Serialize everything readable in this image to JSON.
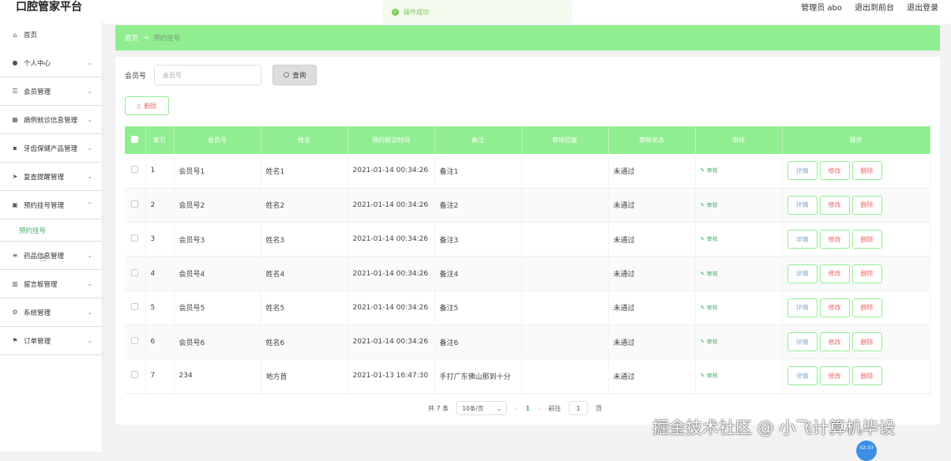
{
  "app": {
    "title": "口腔管家平台"
  },
  "header": {
    "admin_label": "管理员 abo",
    "back_label": "退出到前台",
    "logout_label": "退出登录"
  },
  "toast": {
    "text": "操作成功"
  },
  "sidebar": {
    "items": [
      {
        "label": "首页",
        "icon": "home-icon",
        "glyph": "⌂",
        "chevron": false
      },
      {
        "label": "个人中心",
        "icon": "user-icon",
        "glyph": "●",
        "chevron": true
      },
      {
        "label": "会员管理",
        "icon": "sliders-icon",
        "glyph": "☰",
        "chevron": true
      },
      {
        "label": "病例就诊信息管理",
        "icon": "grid-icon",
        "glyph": "▦",
        "chevron": true
      },
      {
        "label": "牙齿保健产品管理",
        "icon": "tiles-icon",
        "glyph": "▪",
        "chevron": true
      },
      {
        "label": "复查提醒管理",
        "icon": "send-icon",
        "glyph": "➤",
        "chevron": true
      },
      {
        "label": "预约挂号管理",
        "icon": "lock-icon",
        "glyph": "▣",
        "chevron": true,
        "expanded": true
      }
    ],
    "sub_item": "预约挂号",
    "items_after": [
      {
        "label": "药品信息管理",
        "icon": "list-icon",
        "glyph": "≡",
        "chevron": true
      },
      {
        "label": "留言板管理",
        "icon": "trash-icon",
        "glyph": "▥",
        "chevron": true
      },
      {
        "label": "系统管理",
        "icon": "settings-icon",
        "glyph": "⚙",
        "chevron": true
      },
      {
        "label": "订单管理",
        "icon": "flag-icon",
        "glyph": "⚑",
        "chevron": true
      }
    ]
  },
  "breadcrumb": {
    "home": "首页",
    "arrow": "→",
    "current": "预约挂号"
  },
  "search": {
    "label": "会员号",
    "placeholder": "会员号",
    "button": "查询"
  },
  "toolbar": {
    "delete_label": "删除"
  },
  "table": {
    "columns": [
      "索引",
      "会员号",
      "姓名",
      "预约就诊时间",
      "备注",
      "审核回复",
      "审核状态",
      "审核",
      "操作"
    ],
    "rows": [
      {
        "index": "1",
        "member": "会员号1",
        "name": "姓名1",
        "time": "2021-01-14 00:34:26",
        "note": "备注1",
        "reply": "",
        "status": "未通过"
      },
      {
        "index": "2",
        "member": "会员号2",
        "name": "姓名2",
        "time": "2021-01-14 00:34:26",
        "note": "备注2",
        "reply": "",
        "status": "未通过"
      },
      {
        "index": "3",
        "member": "会员号3",
        "name": "姓名3",
        "time": "2021-01-14 00:34:26",
        "note": "备注3",
        "reply": "",
        "status": "未通过"
      },
      {
        "index": "4",
        "member": "会员号4",
        "name": "姓名4",
        "time": "2021-01-14 00:34:26",
        "note": "备注4",
        "reply": "",
        "status": "未通过"
      },
      {
        "index": "5",
        "member": "会员号5",
        "name": "姓名5",
        "time": "2021-01-14 00:34:26",
        "note": "备注5",
        "reply": "",
        "status": "未通过"
      },
      {
        "index": "6",
        "member": "会员号6",
        "name": "姓名6",
        "time": "2021-01-14 00:34:26",
        "note": "备注6",
        "reply": "",
        "status": "未通过"
      },
      {
        "index": "7",
        "member": "234",
        "name": "地方首",
        "time": "2021-01-13 16:47:30",
        "note": "手打广东佛山那到十分",
        "reply": "",
        "status": "未通过"
      }
    ],
    "audit_label": "审核",
    "detail_label": "详情",
    "edit_label": "修改",
    "delete_label": "删除"
  },
  "pagination": {
    "total": "共 7 条",
    "page_size": "10条/页",
    "current_page": "1",
    "goto_label": "前往",
    "goto_value": "1",
    "page_suffix": "页"
  },
  "watermark": "掘金技术社区 @ 小飞计算机毕设",
  "timer": "02:33"
}
